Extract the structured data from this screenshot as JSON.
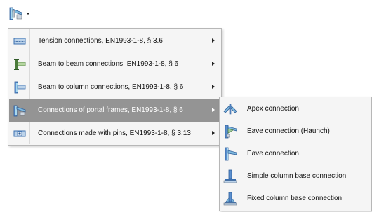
{
  "toolbar": {
    "button_icon": "portal-frame-connection-icon",
    "dropdown_icon": "dropdown-arrow-icon"
  },
  "menu": {
    "items": [
      {
        "label": "Tension connections,  EN1993-1-8, § 3.6",
        "icon": "tension-connection-icon",
        "has_submenu": true
      },
      {
        "label": "Beam to beam connections,  EN1993-1-8, § 6",
        "icon": "beam-to-beam-icon",
        "has_submenu": true
      },
      {
        "label": "Beam to column connections,  EN1993-1-8, § 6",
        "icon": "beam-to-column-icon",
        "has_submenu": true
      },
      {
        "label": "Connections of portal frames,  EN1993-1-8, § 6",
        "icon": "portal-frame-icon",
        "has_submenu": true,
        "highlighted": true
      },
      {
        "label": "Connections made with pins,  EN1993-1-8, § 3.13",
        "icon": "pin-connection-icon",
        "has_submenu": true
      }
    ]
  },
  "submenu": {
    "items": [
      {
        "label": "Apex connection",
        "icon": "apex-connection-icon"
      },
      {
        "label": "Eave connection (Haunch)",
        "icon": "eave-haunch-icon"
      },
      {
        "label": "Eave connection",
        "icon": "eave-connection-icon"
      },
      {
        "label": "Simple column base connection",
        "icon": "simple-base-icon"
      },
      {
        "label": "Fixed column base connection",
        "icon": "fixed-base-icon"
      }
    ]
  },
  "colors": {
    "highlight": "#949494",
    "menu_bg": "#f5f5f5",
    "icon_blue": "#3a6fb0",
    "icon_cyan": "#7fd3e6",
    "icon_green": "#4a7a3a"
  }
}
